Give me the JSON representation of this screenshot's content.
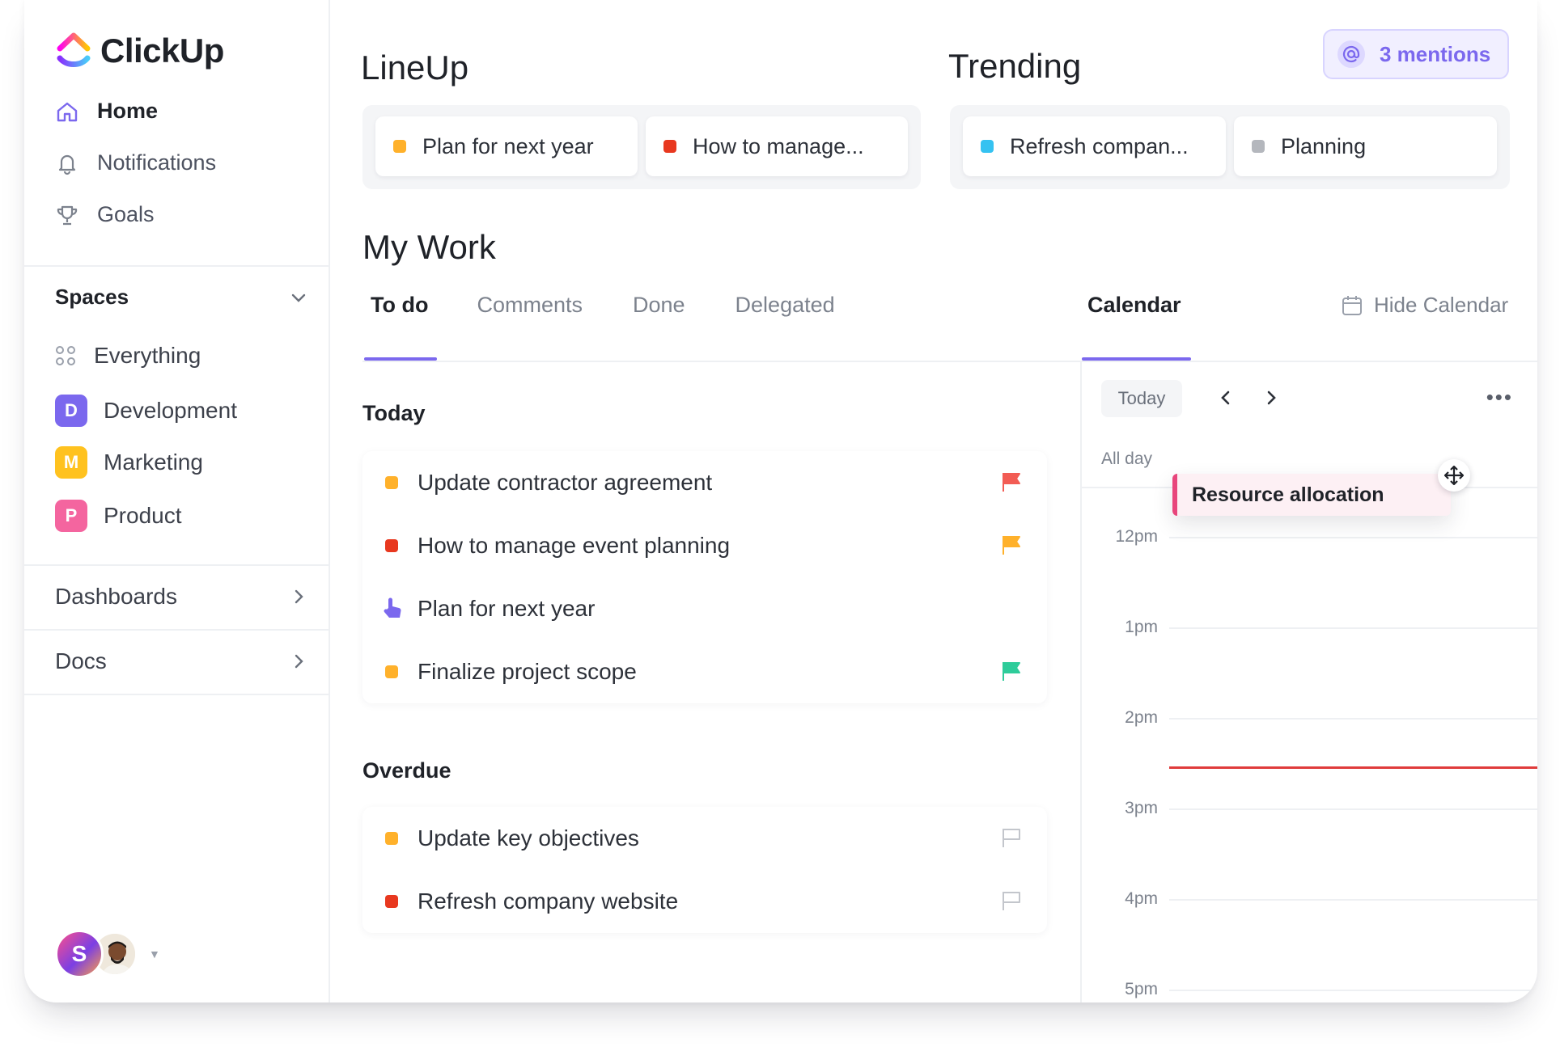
{
  "brand": {
    "name": "ClickUp"
  },
  "nav": [
    {
      "label": "Home",
      "icon": "home-icon",
      "active": true
    },
    {
      "label": "Notifications",
      "icon": "bell-icon"
    },
    {
      "label": "Goals",
      "icon": "trophy-icon"
    }
  ],
  "spaces": {
    "title": "Spaces",
    "everything_label": "Everything",
    "items": [
      {
        "letter": "D",
        "label": "Development",
        "color": "#7b68ee"
      },
      {
        "letter": "M",
        "label": "Marketing",
        "color": "#ffc21f"
      },
      {
        "letter": "P",
        "label": "Product",
        "color": "#f4659f"
      }
    ]
  },
  "sections": [
    {
      "label": "Dashboards"
    },
    {
      "label": "Docs"
    }
  ],
  "user": {
    "initial": "S"
  },
  "lineup": {
    "title": "LineUp",
    "items": [
      {
        "label": "Plan for next year",
        "color": "#ffb12b"
      },
      {
        "label": "How to manage...",
        "color": "#e8381f"
      }
    ]
  },
  "trending": {
    "title": "Trending",
    "items": [
      {
        "label": "Refresh compan...",
        "color": "#35c2f1"
      },
      {
        "label": "Planning",
        "color": "#b4b7bd"
      }
    ]
  },
  "mentions": {
    "label": "3 mentions"
  },
  "mywork": {
    "title": "My Work",
    "tabs": [
      "To do",
      "Comments",
      "Done",
      "Delegated"
    ],
    "active_tab": "To do",
    "groups": [
      {
        "title": "Today",
        "tasks": [
          {
            "label": "Update contractor agreement",
            "status_color": "#ffb12b",
            "flag": "red"
          },
          {
            "label": "How to manage event planning",
            "status_color": "#e8381f",
            "flag": "yellow"
          },
          {
            "label": "Plan for next year",
            "status_color": "#7b68ee",
            "flag": "none",
            "dragging": true
          },
          {
            "label": "Finalize project scope",
            "status_color": "#ffb12b",
            "flag": "green"
          }
        ]
      },
      {
        "title": "Overdue",
        "tasks": [
          {
            "label": "Update key objectives",
            "status_color": "#ffb12b",
            "flag": "empty"
          },
          {
            "label": "Refresh company website",
            "status_color": "#e8381f",
            "flag": "empty"
          }
        ]
      }
    ]
  },
  "calendar": {
    "tab_label": "Calendar",
    "hide_label": "Hide Calendar",
    "today_label": "Today",
    "all_day_label": "All day",
    "hours": [
      "12pm",
      "1pm",
      "2pm",
      "3pm",
      "4pm",
      "5pm"
    ],
    "event": {
      "label": "Resource allocation",
      "color": "#e8467c"
    },
    "now_indicator_color": "#e03b3b"
  },
  "flag_colors": {
    "red": "#f25c54",
    "yellow": "#ffb12b",
    "green": "#2ecc9a",
    "empty": "#c3c6cc"
  }
}
